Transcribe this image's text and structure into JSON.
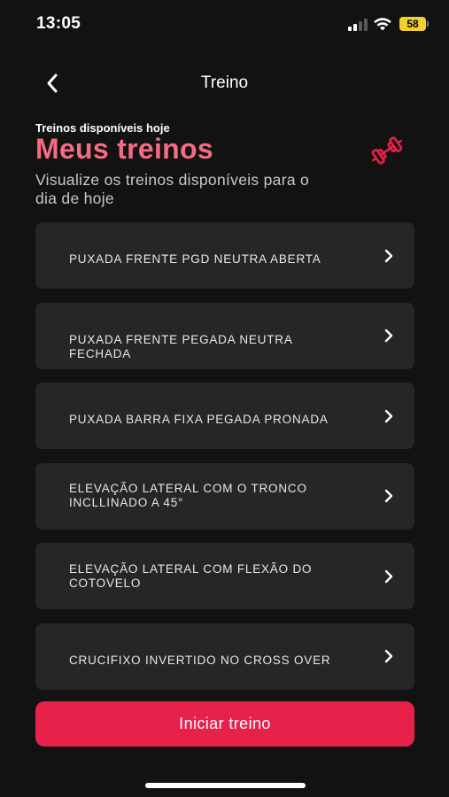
{
  "status_bar": {
    "time": "13:05",
    "battery": "58"
  },
  "nav": {
    "title": "Treino"
  },
  "header": {
    "subtitle": "Treinos disponíveis hoje",
    "title": "Meus treinos",
    "description": "Visualize os treinos disponíveis para o dia de hoje"
  },
  "workouts": [
    {
      "label": "PUXADA FRENTE PGD NEUTRA ABERTA"
    },
    {
      "label": "PUXADA FRENTE PEGADA NEUTRA FECHADA"
    },
    {
      "label": "PUXADA BARRA FIXA PEGADA PRONADA"
    },
    {
      "label": "ELEVAÇÃO LATERAL COM O TRONCO INCLLINADO A 45°"
    },
    {
      "label": "ELEVAÇÃO LATERAL COM FLEXÃO DO COTOVELO"
    },
    {
      "label": "CRUCIFIXO INVERTIDO NO CROSS OVER"
    }
  ],
  "actions": {
    "start_label": "Iniciar treino"
  },
  "colors": {
    "accent": "#e8214a",
    "title": "#f56b83",
    "card": "#262626",
    "background": "#121212"
  },
  "icons": {
    "back": "chevron-left-icon",
    "header": "dumbbell-icon",
    "row": "chevron-right-icon"
  }
}
